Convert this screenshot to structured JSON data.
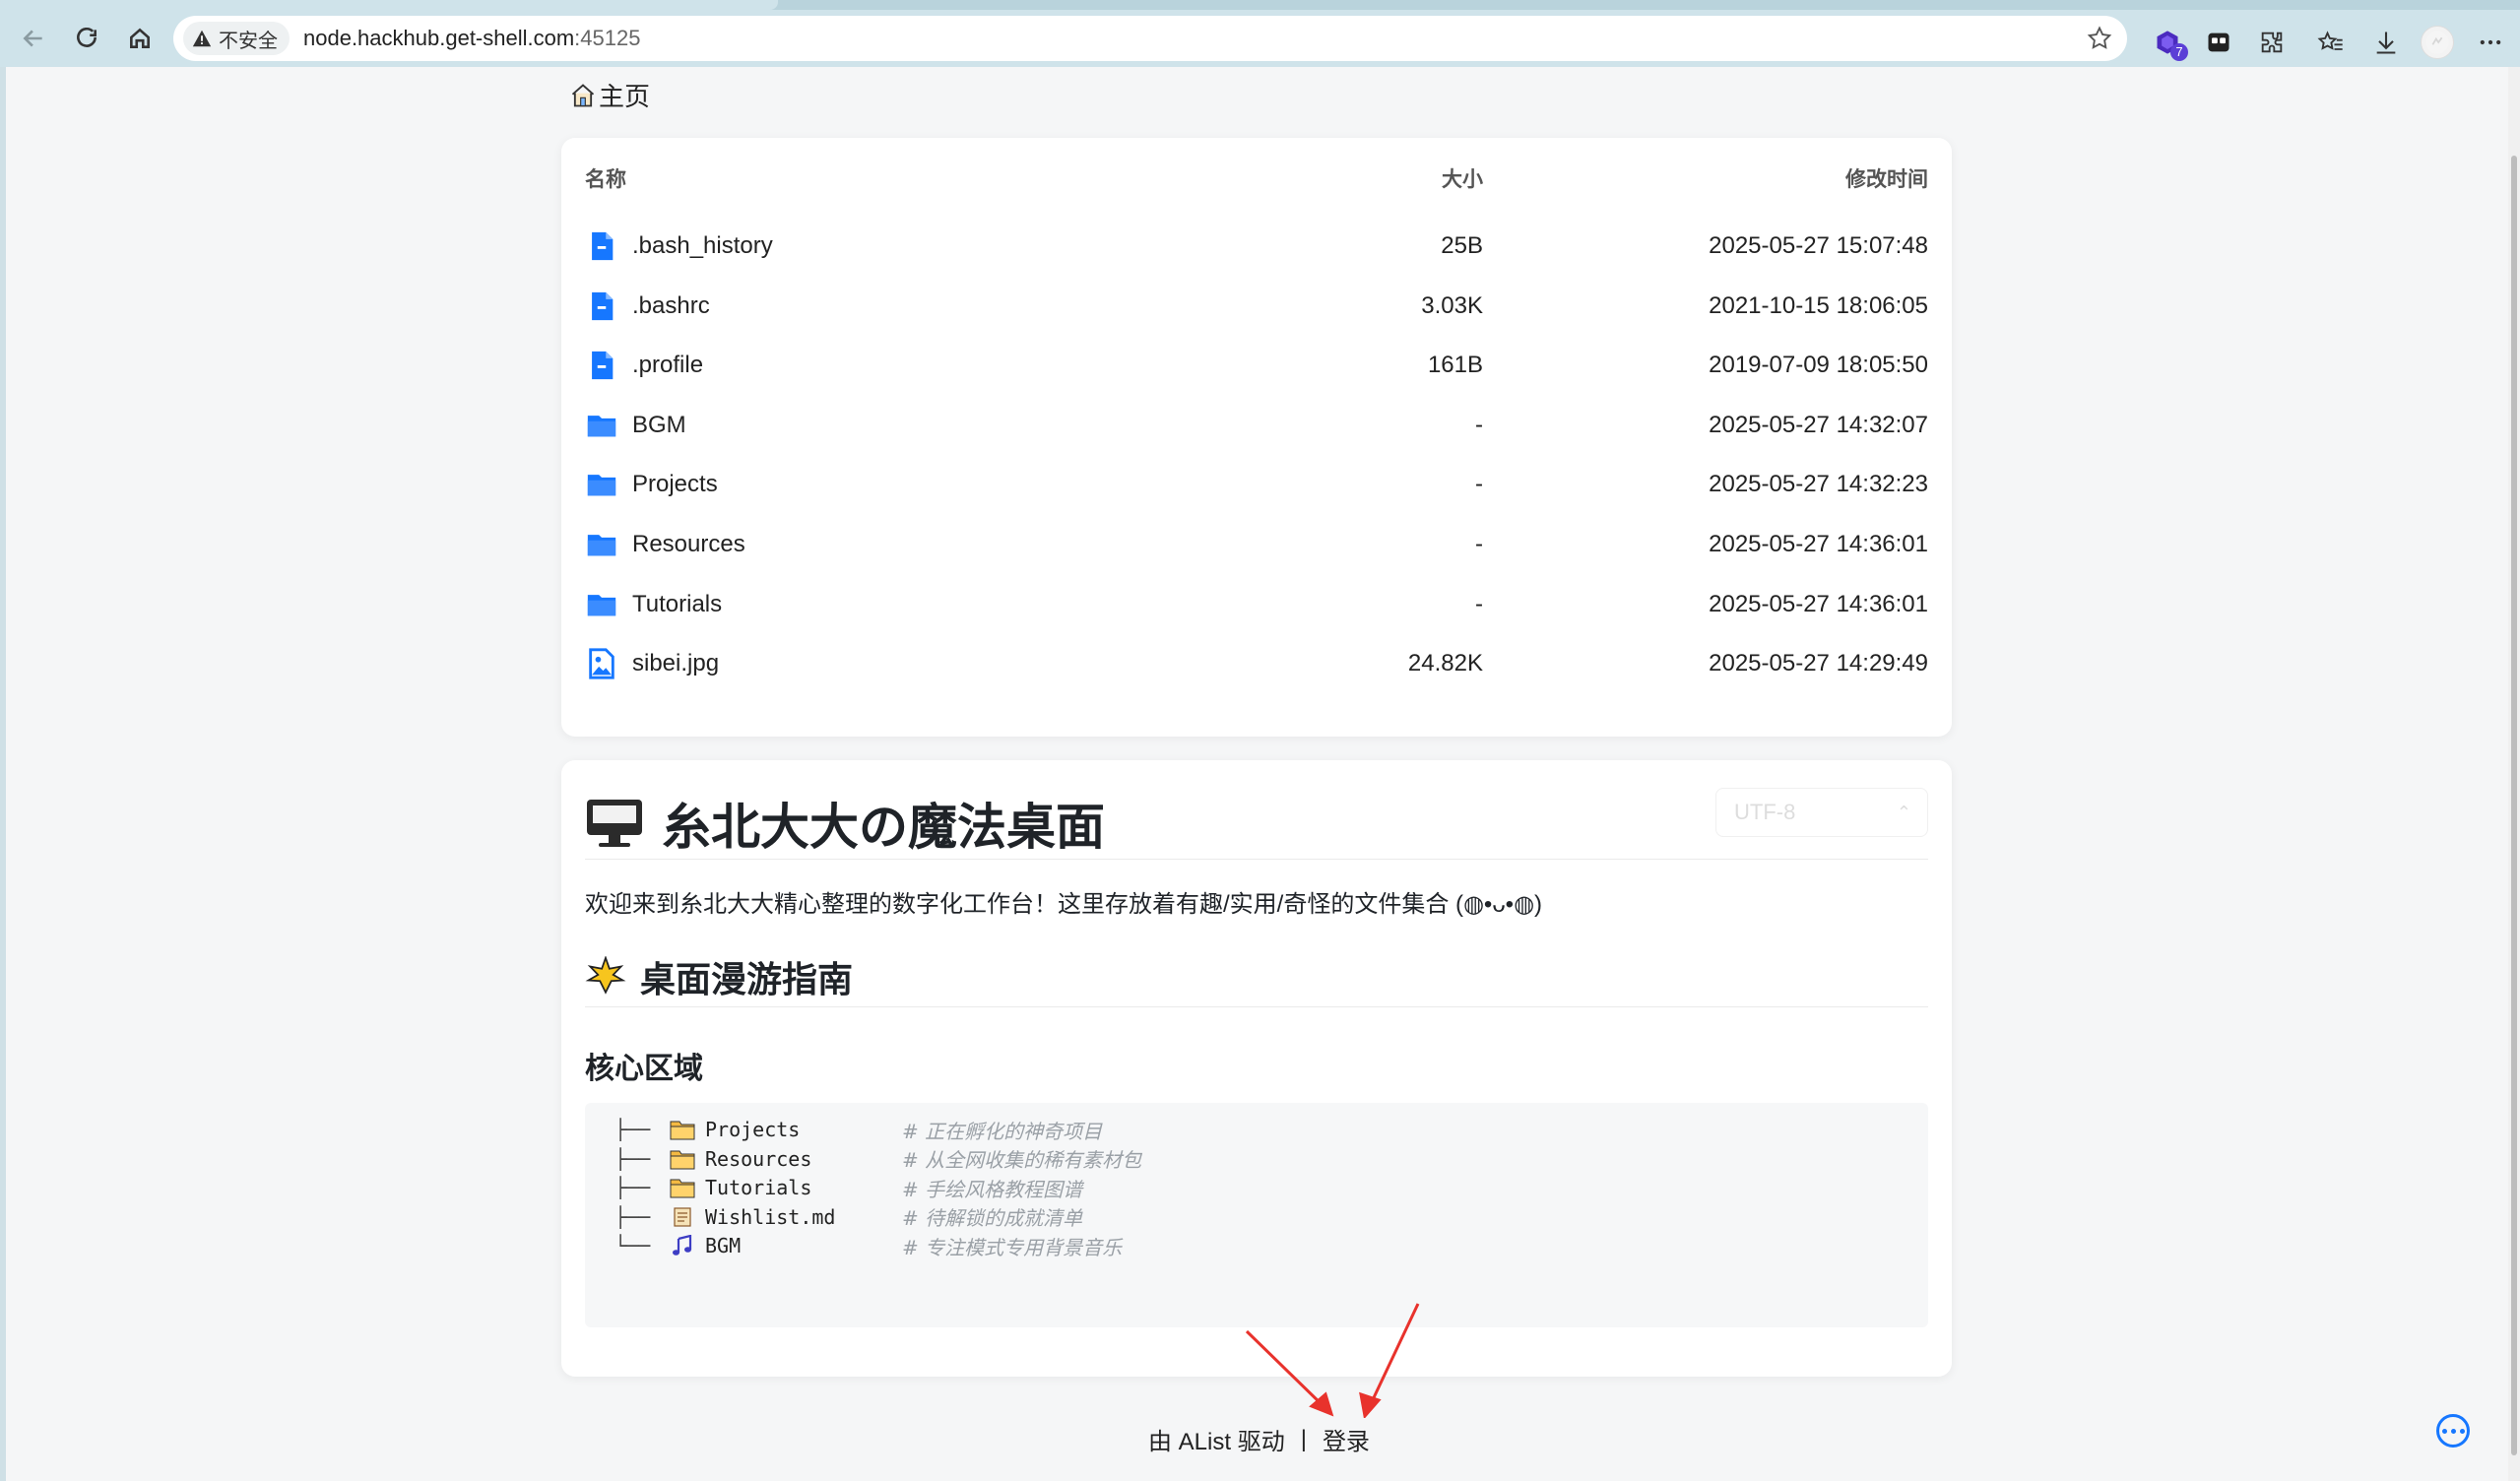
{
  "browser": {
    "security_label": "不安全",
    "url_host": "node.hackhub.get-shell.com",
    "url_port": ":45125",
    "extension_badge": "7"
  },
  "breadcrumb": {
    "home_label": "主页"
  },
  "file_list": {
    "headers": {
      "name": "名称",
      "size": "大小",
      "modified": "修改时间"
    },
    "rows": [
      {
        "name": ".bash_history",
        "size": "25B",
        "modified": "2025-05-27 15:07:48",
        "icon": "file-icon"
      },
      {
        "name": ".bashrc",
        "size": "3.03K",
        "modified": "2021-10-15 18:06:05",
        "icon": "file-icon"
      },
      {
        "name": ".profile",
        "size": "161B",
        "modified": "2019-07-09 18:05:50",
        "icon": "file-icon"
      },
      {
        "name": "BGM",
        "size": "-",
        "modified": "2025-05-27 14:32:07",
        "icon": "folder-icon"
      },
      {
        "name": "Projects",
        "size": "-",
        "modified": "2025-05-27 14:32:23",
        "icon": "folder-icon"
      },
      {
        "name": "Resources",
        "size": "-",
        "modified": "2025-05-27 14:36:01",
        "icon": "folder-icon"
      },
      {
        "name": "Tutorials",
        "size": "-",
        "modified": "2025-05-27 14:36:01",
        "icon": "folder-icon"
      },
      {
        "name": "sibei.jpg",
        "size": "24.82K",
        "modified": "2025-05-27 14:29:49",
        "icon": "image-icon"
      }
    ]
  },
  "readme": {
    "title": "糸北大大の魔法桌面",
    "encoding": "UTF-8",
    "welcome": "欢迎来到糸北大大精心整理的数字化工作台！这里存放着有趣/实用/奇怪的文件集合 (◍•ᴗ•◍)",
    "guide_title": "桌面漫游指南",
    "core_title": "核心区域",
    "tree": [
      {
        "branch": "├──",
        "name": "Projects",
        "comment": "# 正在孵化的神奇项目",
        "icon": "folder-emoji-icon"
      },
      {
        "branch": "├──",
        "name": "Resources",
        "comment": "# 从全网收集的稀有素材包",
        "icon": "folder-emoji-icon"
      },
      {
        "branch": "├──",
        "name": "Tutorials",
        "comment": "# 手绘风格教程图谱",
        "icon": "folder-emoji-icon"
      },
      {
        "branch": "├──",
        "name": "Wishlist.md",
        "comment": "# 待解锁的成就清单",
        "icon": "scroll-icon"
      },
      {
        "branch": "└──",
        "name": "BGM",
        "comment": "# 专注模式专用背景音乐",
        "icon": "music-icon"
      }
    ]
  },
  "footer": {
    "powered_by": "由 AList 驱动",
    "separator": "|",
    "login": "登录"
  },
  "colors": {
    "accent": "#1677ff",
    "annotation_arrow": "#e8322c"
  }
}
